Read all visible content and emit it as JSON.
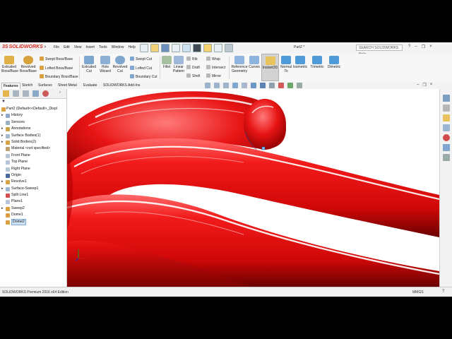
{
  "app": {
    "logo_text": "SOLIDWORKS",
    "logo_prefix": "3S",
    "document_title": "Part2 *",
    "search_placeholder": "SEARCH SOLIDWORKS Help",
    "brand_red": "#d52b1e"
  },
  "menu": [
    "File",
    "Edit",
    "View",
    "Insert",
    "Tools",
    "Window",
    "Help"
  ],
  "ribbon": {
    "extruded_boss": "Extruded Boss/Base",
    "revolved_boss": "Revolved Boss/Base",
    "swept_boss": "Swept Boss/Base",
    "lofted_boss": "Lofted Boss/Base",
    "boundary_boss": "Boundary Boss/Base",
    "extruded_cut": "Extruded Cut",
    "hole_wizard": "Hole Wizard",
    "revolved_cut": "Revolved Cut",
    "swept_cut": "Swept Cut",
    "lofted_cut": "Lofted Cut",
    "boundary_cut": "Boundary Cut",
    "fillet": "Fillet",
    "linear_pattern": "Linear Pattern",
    "rib": "Rib",
    "draft": "Draft",
    "shell": "Shell",
    "wrap": "Wrap",
    "intersect": "Intersect",
    "mirror": "Mirror",
    "reference_geometry": "Reference Geometry",
    "curves": "Curves",
    "instant3d": "Instant3D",
    "normal_to": "Normal To",
    "isometric": "Isometric",
    "trimetric": "Trimetric",
    "dimetric": "Dimetric"
  },
  "tabs": [
    "Features",
    "Sketch",
    "Surfaces",
    "Sheet Metal",
    "Evaluate",
    "SOLIDWORKS Add-Ins"
  ],
  "active_tab": "Features",
  "tree": {
    "root": "Part2  (Default<<Default>_Displ",
    "items": [
      {
        "label": "History",
        "indent": 1,
        "expand": "▸",
        "icon": "history-icon"
      },
      {
        "label": "Sensors",
        "indent": 1,
        "expand": "",
        "icon": "sensors-icon"
      },
      {
        "label": "Annotations",
        "indent": 1,
        "expand": "▸",
        "icon": "annotations-icon"
      },
      {
        "label": "Surface Bodies(1)",
        "indent": 1,
        "expand": "▸",
        "icon": "surface-bodies-icon"
      },
      {
        "label": "Solid Bodies(2)",
        "indent": 1,
        "expand": "▸",
        "icon": "solid-bodies-icon"
      },
      {
        "label": "Material <not specified>",
        "indent": 1,
        "expand": "",
        "icon": "material-icon"
      },
      {
        "label": "Front Plane",
        "indent": 1,
        "expand": "",
        "icon": "plane-icon"
      },
      {
        "label": "Top Plane",
        "indent": 1,
        "expand": "",
        "icon": "plane-icon"
      },
      {
        "label": "Right Plane",
        "indent": 1,
        "expand": "",
        "icon": "plane-icon"
      },
      {
        "label": "Origin",
        "indent": 1,
        "expand": "",
        "icon": "origin-icon"
      },
      {
        "label": "Revolve1",
        "indent": 1,
        "expand": "▸",
        "icon": "revolve-icon"
      },
      {
        "label": "Surface-Sweep1",
        "indent": 1,
        "expand": "▸",
        "icon": "surface-sweep-icon"
      },
      {
        "label": "Split Line1",
        "indent": 1,
        "expand": "",
        "icon": "split-line-icon"
      },
      {
        "label": "Plane1",
        "indent": 1,
        "expand": "",
        "icon": "plane-icon"
      },
      {
        "label": "Sweep2",
        "indent": 1,
        "expand": "▸",
        "icon": "sweep-icon"
      },
      {
        "label": "Dome1",
        "indent": 1,
        "expand": "",
        "icon": "dome-icon"
      },
      {
        "label": "Dome2",
        "indent": 1,
        "expand": "",
        "icon": "dome-icon",
        "selected": true
      }
    ]
  },
  "status": {
    "text": "SOLIDWORKS Premium 2016 x64 Edition",
    "units": "MMGS",
    "help": "?"
  },
  "colors": {
    "model_red": "#e01010",
    "model_dark": "#7a0000",
    "highlight": "#ffffff",
    "selection_blue": "#cfe3f8"
  }
}
